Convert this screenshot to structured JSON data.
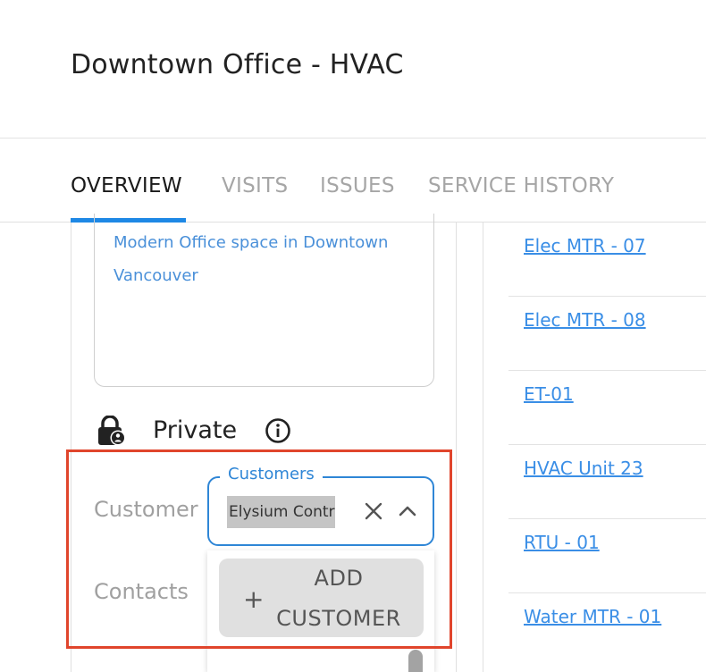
{
  "page": {
    "title": "Downtown Office - HVAC"
  },
  "tabs": [
    {
      "label": "OVERVIEW",
      "active": true
    },
    {
      "label": "VISITS",
      "active": false
    },
    {
      "label": "ISSUES",
      "active": false
    },
    {
      "label": "SERVICE HISTORY",
      "active": false
    }
  ],
  "overview": {
    "description": "Modern Office space in Downtown Vancouver",
    "privacy_label": "Private",
    "customer_field": {
      "label": "Customer",
      "select_legend": "Customers",
      "selected_value": "Elysium Contractors",
      "add_button_label": "ADD CUSTOMER",
      "add_button_icon": "+"
    },
    "contacts_field": {
      "label": "Contacts"
    }
  },
  "equipment": [
    {
      "name": "Elec MTR - 07"
    },
    {
      "name": "Elec MTR - 08"
    },
    {
      "name": "ET-01"
    },
    {
      "name": "HVAC Unit 23"
    },
    {
      "name": "RTU - 01"
    },
    {
      "name": "Water MTR - 01"
    }
  ],
  "colors": {
    "accent": "#1e88e5",
    "link": "#3a8ee6",
    "highlight": "#e0452c"
  }
}
